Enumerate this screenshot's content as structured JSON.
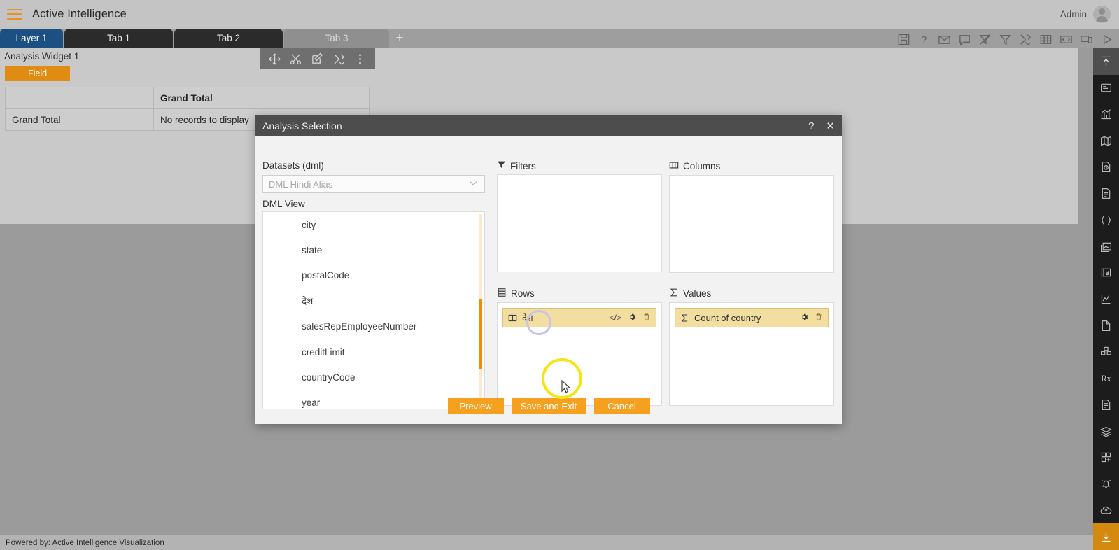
{
  "header": {
    "menu_icon": "hamburger-icon",
    "app_title": "Active Intelligence",
    "user_name": "Admin",
    "avatar_icon": "user-avatar-icon"
  },
  "tabs": {
    "items": [
      {
        "label": "Layer 1",
        "state": "layer"
      },
      {
        "label": "Tab 1",
        "state": "dark"
      },
      {
        "label": "Tab 2",
        "state": "dark"
      },
      {
        "label": "Tab 3",
        "state": "active"
      }
    ],
    "add_label": "+",
    "toolbar_icons": [
      "save-icon",
      "help-icon",
      "mail-icon",
      "comment-icon",
      "clear-filter-icon",
      "filter-icon",
      "tools-icon",
      "table-icon",
      "code-window-icon",
      "copy-screen-icon",
      "play-icon"
    ]
  },
  "widget": {
    "title": "Analysis Widget 1",
    "field_pill": "Field",
    "tool_icons": [
      "move-icon",
      "cut-icon",
      "edit-icon",
      "settings-tools-icon",
      "kebab-menu-icon"
    ],
    "pivot": {
      "header_row": [
        "",
        "Grand Total"
      ],
      "body_row": [
        "Grand Total",
        "No records to display"
      ]
    }
  },
  "right_sidebar": {
    "items": [
      {
        "icon": "collapse-up-icon",
        "selected": true
      },
      {
        "icon": "widget-icon",
        "selected": false
      },
      {
        "icon": "chart-icon",
        "selected": false
      },
      {
        "icon": "map-icon",
        "selected": false
      },
      {
        "icon": "document-clock-icon",
        "selected": false
      },
      {
        "icon": "file-text-icon",
        "selected": false
      },
      {
        "icon": "braces-icon",
        "selected": false
      },
      {
        "icon": "images-icon",
        "selected": false
      },
      {
        "icon": "media-card-icon",
        "selected": false
      },
      {
        "icon": "sparkline-icon",
        "selected": false
      },
      {
        "icon": "page-corner-icon",
        "selected": false
      },
      {
        "icon": "cubes-icon",
        "selected": false
      },
      {
        "icon": "rx-icon",
        "selected": false
      },
      {
        "icon": "report-icon",
        "selected": false
      },
      {
        "icon": "layers-icon",
        "selected": false
      },
      {
        "icon": "add-tile-icon",
        "selected": false
      },
      {
        "icon": "alert-bell-icon",
        "selected": false
      },
      {
        "icon": "cloud-upload-icon",
        "selected": false
      },
      {
        "icon": "download-icon",
        "selected": true
      }
    ]
  },
  "footer": {
    "text": "Powered by: Active Intelligence Visualization"
  },
  "dialog": {
    "title": "Analysis Selection",
    "help_label": "?",
    "close_label": "✕",
    "datasets_label": "Datasets (dml)",
    "dataset_placeholder": "DML Hindi Alias",
    "dmlview_label": "DML View",
    "fields": [
      "city",
      "state",
      "postalCode",
      "देश",
      "salesRepEmployeeNumber",
      "creditLimit",
      "countryCode",
      "year"
    ],
    "zones": {
      "filters": {
        "label": "Filters",
        "icon": "filter-icon",
        "chips": []
      },
      "columns": {
        "label": "Columns",
        "icon": "columns-icon",
        "chips": []
      },
      "rows": {
        "label": "Rows",
        "icon": "rows-icon",
        "chips": [
          {
            "text": "देश",
            "lead_icon": "column-icon",
            "actions": [
              "code-icon",
              "gear-icon",
              "trash-icon"
            ]
          }
        ]
      },
      "values": {
        "label": "Values",
        "icon": "sigma-icon",
        "chips": [
          {
            "text": "Count of country",
            "lead_icon": "sigma-icon",
            "actions": [
              "gear-icon",
              "trash-icon"
            ]
          }
        ]
      }
    },
    "buttons": {
      "preview": "Preview",
      "save_and_exit": "Save and Exit",
      "cancel": "Cancel"
    }
  },
  "colors": {
    "accent_orange": "#f5a01e",
    "chip_yellow": "#f2dea0",
    "layer_blue": "#1c4f82",
    "highlight_yellow": "#f5e514",
    "highlight_lavender": "#c8c3e8"
  }
}
